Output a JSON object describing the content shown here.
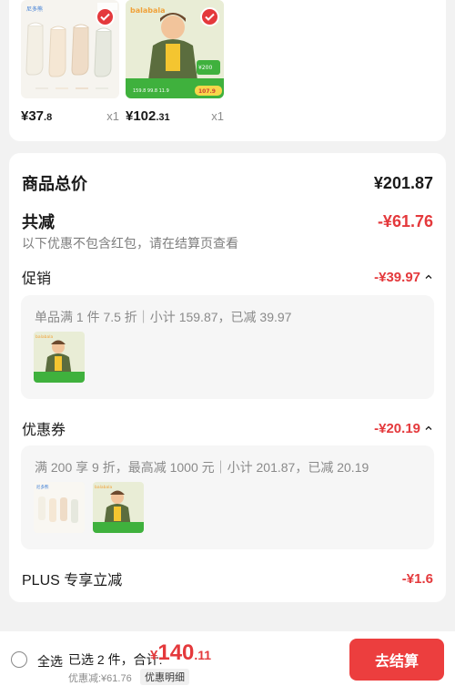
{
  "products": [
    {
      "brand": "尼多熊",
      "tag": "福利·包邮",
      "price_int": "¥37",
      "price_dec": ".8",
      "qty": "x1"
    },
    {
      "brand": "balabala",
      "price_int": "¥102",
      "price_dec": ".31",
      "qty": "x1"
    }
  ],
  "summary": {
    "total_label": "商品总价",
    "total_value": "¥201.87",
    "reduce_label": "共减",
    "reduce_value": "-¥61.76",
    "note": "以下优惠不包含红包，请在结算页查看",
    "promo_label": "促销",
    "promo_value": "-¥39.97",
    "promo_desc": "单品满 1 件 7.5 折｜小计 159.87，已减 39.97",
    "coupon_label": "优惠券",
    "coupon_value": "-¥20.19",
    "coupon_desc": "满 200 享 9 折，最高减 1000 元｜小计 201.87，已减 20.19",
    "plus_label": "PLUS 专享立减",
    "plus_value": "-¥1.6"
  },
  "bottom": {
    "select_all": "全选",
    "selected_text": "已选 2 件，合计:",
    "total_yen": "¥",
    "total_int": "140",
    "total_dec": ".11",
    "saved": "优惠减:¥61.76",
    "detail_btn": "优惠明细",
    "checkout_btn": "去结算"
  },
  "colors": {
    "accent": "#e4393c",
    "checkout": "#ec3e3e"
  }
}
